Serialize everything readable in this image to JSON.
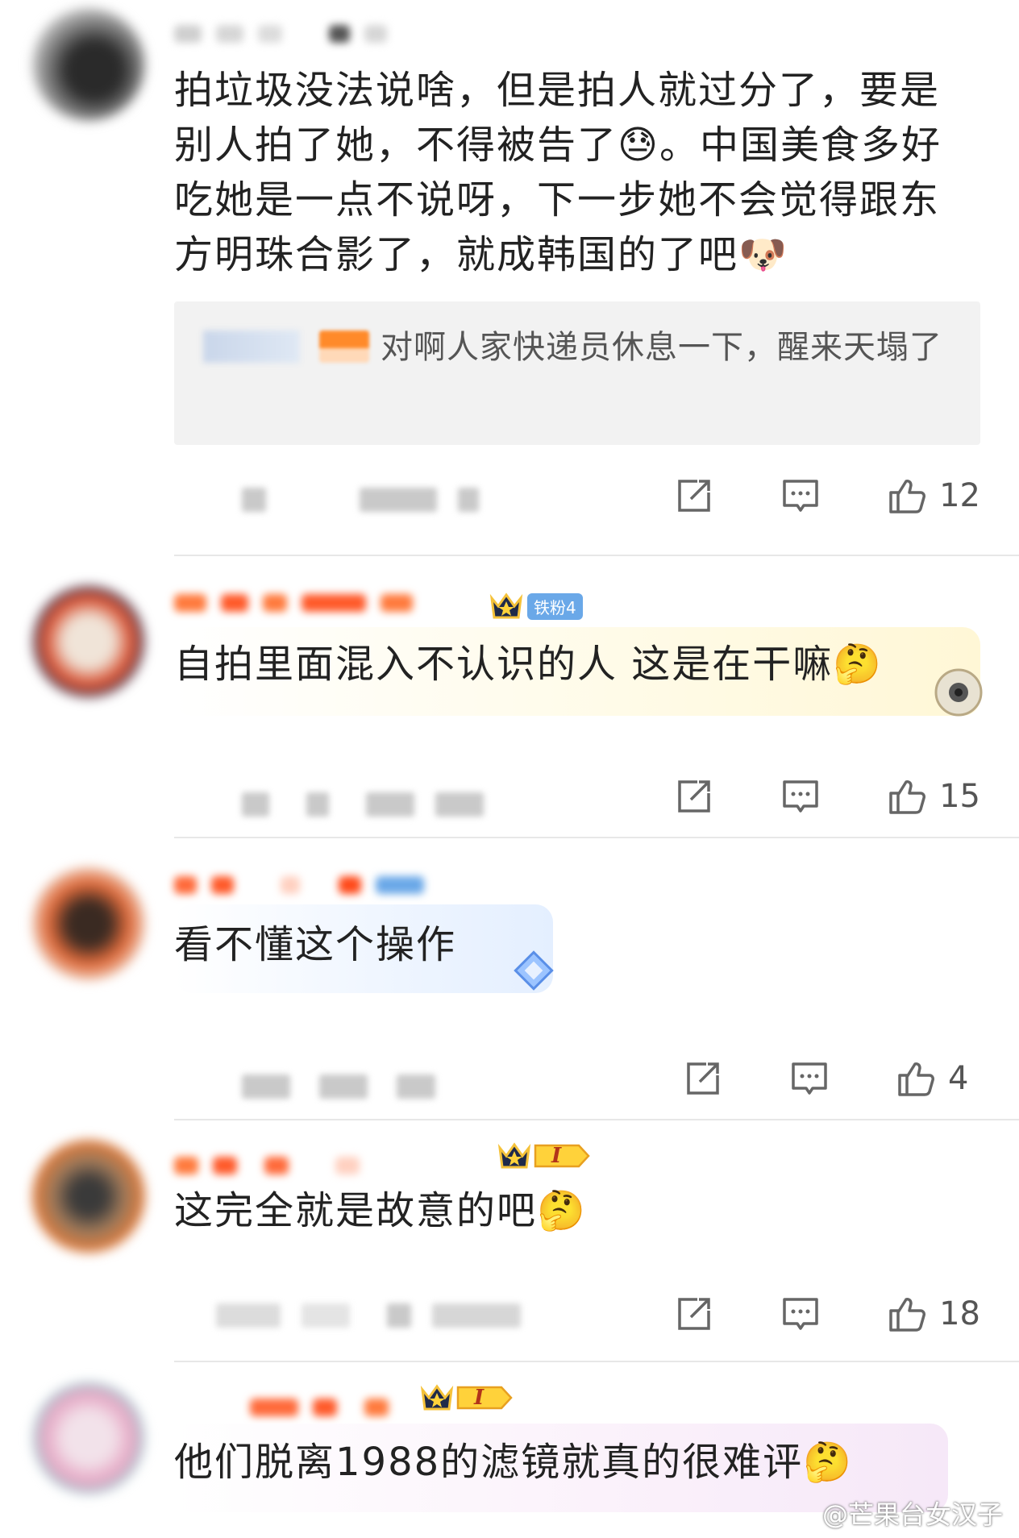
{
  "comments": [
    {
      "text": "拍垃圾没法说啥，但是拍人就过分了，要是别人拍了她，不得被告了😓。中国美食多好吃她是一点不说呀，下一步她不会觉得跟东方明珠合影了，就成韩国的了吧🐶",
      "reply": "对啊人家快递员休息一下，醒来天塌了",
      "likes": "12"
    },
    {
      "badge": "铁粉4",
      "text": "自拍里面混入不认识的人 这是在干嘛🤔",
      "likes": "15"
    },
    {
      "text": "看不懂这个操作",
      "likes": "4"
    },
    {
      "badge_level": "I",
      "text": "这完全就是故意的吧🤔",
      "likes": "18"
    },
    {
      "badge_level": "I",
      "text": "他们脱离1988的滤镜就真的很难评🤔"
    }
  ],
  "watermark": "@芒果台女汉子",
  "icons": {
    "share": "share-icon",
    "comment": "comment-icon",
    "like": "thumbs-up-icon",
    "crown": "crown-icon",
    "emoji_sweat": "sweat-emoji-icon",
    "emoji_dog": "dog-emoji-icon",
    "emoji_thinking": "thinking-emoji-icon"
  },
  "colors": {
    "fan_badge": "#6aa8e8",
    "level_badge": "#ffc93a",
    "divider": "#e7e7e7",
    "reply_bg": "#f2f2f2"
  }
}
